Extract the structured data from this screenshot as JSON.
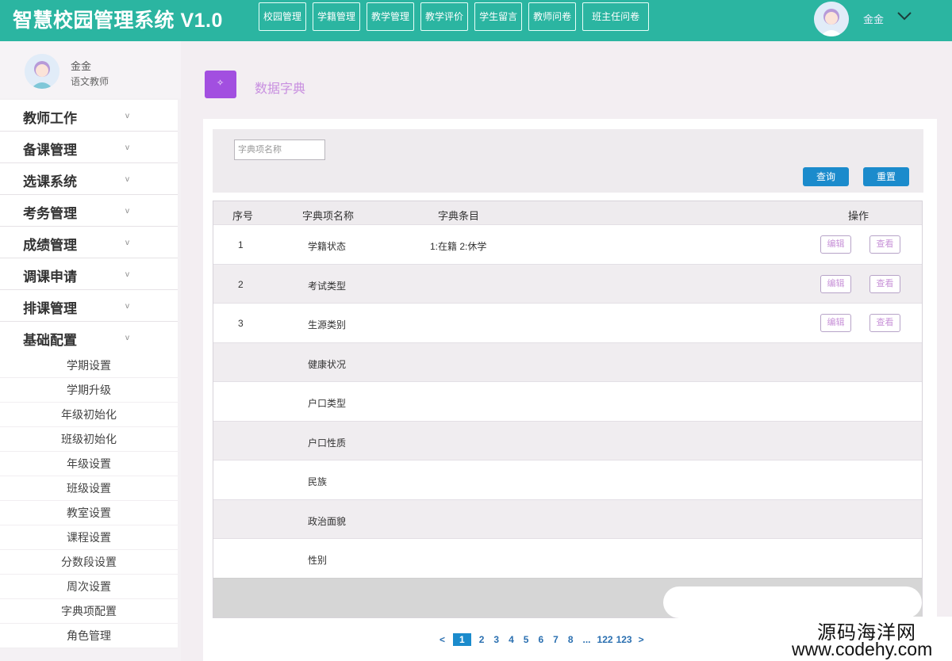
{
  "app": {
    "title": "智慧校园管理系统 V1.0"
  },
  "topnav": {
    "items": [
      "校园管理",
      "学籍管理",
      "教学管理",
      "教学评价",
      "学生留言",
      "教师问卷",
      "班主任问卷"
    ]
  },
  "user": {
    "name": "金金",
    "role": "语文教师"
  },
  "sidebar": {
    "menu": [
      {
        "label": "教师工作"
      },
      {
        "label": "备课管理"
      },
      {
        "label": "选课系统"
      },
      {
        "label": "考务管理"
      },
      {
        "label": "成绩管理"
      },
      {
        "label": "调课申请"
      },
      {
        "label": "排课管理"
      },
      {
        "label": "基础配置"
      }
    ],
    "caret": "v",
    "submenu": [
      "学期设置",
      "学期升级",
      "年级初始化",
      "班级初始化",
      "年级设置",
      "班级设置",
      "教室设置",
      "课程设置",
      "分数段设置",
      "周次设置",
      "字典项配置",
      "角色管理"
    ]
  },
  "page": {
    "title": "数据字典",
    "icon_symbol": "✧",
    "icon_color": "#a24fe0"
  },
  "search": {
    "placeholder": "字典项名称",
    "query_label": "查询",
    "reset_label": "重置"
  },
  "table": {
    "headers": {
      "index": "序号",
      "name": "字典项名称",
      "entries": "字典条目",
      "actions": "操作"
    },
    "rows": [
      {
        "index": "1",
        "name": "学籍状态",
        "entries": "1:在籍 2:休学",
        "edit": "编辑",
        "view": "查看"
      },
      {
        "index": "2",
        "name": "考试类型",
        "entries": "",
        "edit": "编辑",
        "view": "查看"
      },
      {
        "index": "3",
        "name": "生源类别",
        "entries": "",
        "edit": "编辑",
        "view": "查看"
      },
      {
        "index": "",
        "name": "健康状况",
        "entries": ""
      },
      {
        "index": "",
        "name": "户口类型",
        "entries": ""
      },
      {
        "index": "",
        "name": "户口性质",
        "entries": ""
      },
      {
        "index": "",
        "name": "民族",
        "entries": ""
      },
      {
        "index": "",
        "name": "政治面貌",
        "entries": ""
      },
      {
        "index": "",
        "name": "性别",
        "entries": ""
      }
    ]
  },
  "pagination": {
    "prev": "<",
    "next": ">",
    "pages": [
      "1",
      "2",
      "3",
      "4",
      "5",
      "6",
      "7",
      "8",
      "...",
      "122",
      "123"
    ],
    "current": "1"
  },
  "watermark": {
    "line1": "源码海洋网",
    "line2": "www.codehy.com"
  },
  "colors": {
    "topbar": "#2bb5a1",
    "accent_blue": "#1b8bcc",
    "purple": "#a24fe0"
  }
}
